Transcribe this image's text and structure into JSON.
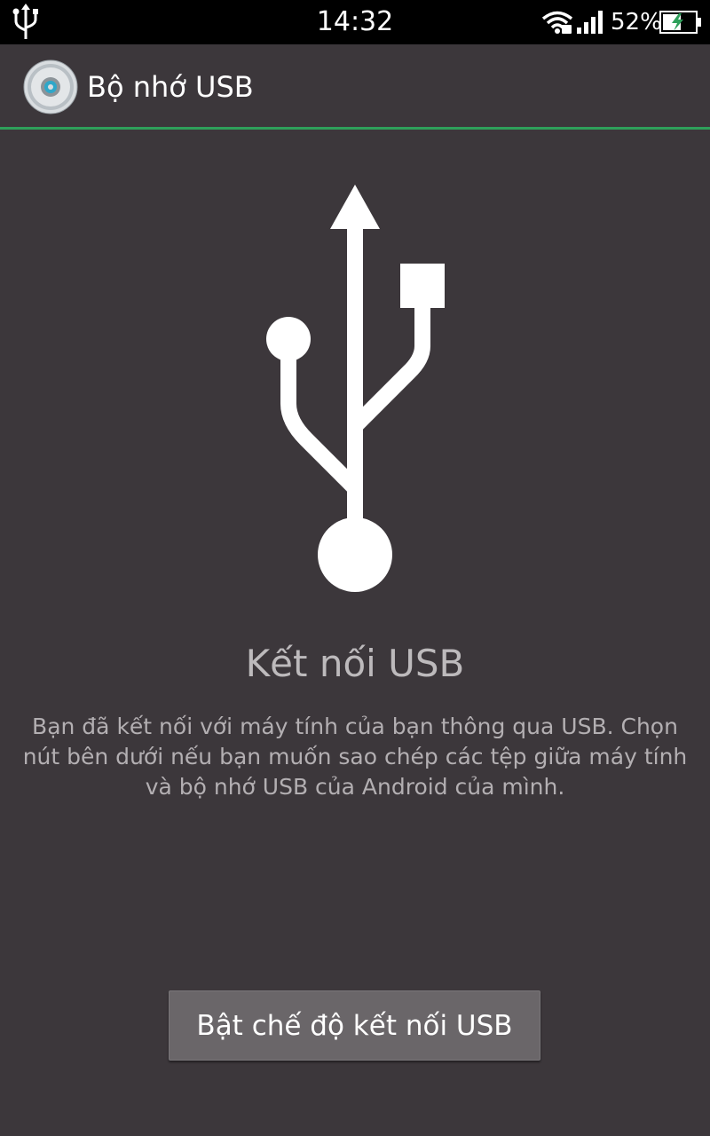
{
  "status_bar": {
    "time": "14:32",
    "battery_percent": "52%",
    "battery_level": 0.52,
    "icons": [
      "usb-icon",
      "wifi-icon",
      "signal-icon",
      "battery-charging-icon"
    ]
  },
  "action_bar": {
    "title": "Bộ nhớ USB",
    "icon": "usb-storage-disc-icon"
  },
  "main": {
    "illustration": "usb-symbol-icon",
    "heading": "Kết nối USB",
    "description": "Bạn đã kết nối với máy tính của bạn thông qua USB. Chọn nút bên dưới nếu bạn muốn sao chép các tệp giữa máy tính và bộ nhớ USB của Android của mình.",
    "button_label": "Bật chế độ kết nối USB"
  },
  "colors": {
    "background": "#3c373b",
    "status_bar": "#000000",
    "accent_line": "#2ea05a",
    "button": "#6a6669"
  }
}
